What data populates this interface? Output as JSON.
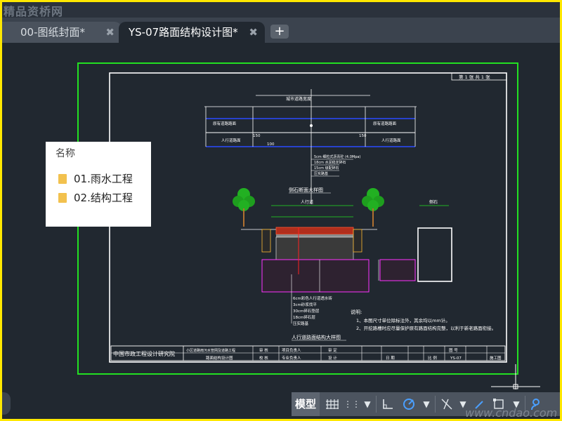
{
  "watermark_top": "精品资桥网",
  "watermark_bottom": "www.cndao.com",
  "tabs": [
    {
      "label": "00-图纸封面*",
      "close": "✖"
    },
    {
      "label": "YS-07路面结构设计图*",
      "close": "✖"
    }
  ],
  "tab_add": "+",
  "popup": {
    "header": "名称",
    "items": [
      {
        "label": "01.雨水工程"
      },
      {
        "label": "02.结构工程"
      }
    ]
  },
  "status": {
    "model": "模型",
    "icons": [
      "grid-icon",
      "dropdown-icon",
      "ortho-icon",
      "polar-icon",
      "dropdown-icon",
      "osnap-icon",
      "dropdown-icon",
      "annotation-icon",
      "dropdown-icon",
      "user-icon"
    ]
  },
  "drawing": {
    "sheet_no": "第 1 张 共 1 张",
    "road_width": "城市道路宽度",
    "label_left_1": "原有道路路面",
    "label_left_2": "人行道路面",
    "label_right_1": "原有道路路面",
    "label_right_2": "人行道路面",
    "dim_1": "150",
    "dim_2": "100",
    "dim_3": "150",
    "layer_1": "5cm 细粒式沥青砼 (4.0Mpa)",
    "layer_2": "18cm 水泥稳定碎石",
    "layer_3": "15cm 级配碎石",
    "layer_4": "压实路基",
    "section_title": "侧石断面大样图",
    "sidewalk_label": "人行道",
    "curb_label": "侧石",
    "mat_1": "6cm彩色人行道透水砖",
    "mat_2": "3cm砂浆找平",
    "mat_3": "30cm碎石垫层",
    "mat_4": "18cm碎石层",
    "mat_5": "压实路基",
    "bottom_title": "人行道路面结构大样图",
    "notes_title": "说明:",
    "note_1": "1、本图尺寸单位除标注外，其余均以mm计。",
    "note_2": "2、开挖路槽时应尽量保护原有路面结构完整，以利于新老路面衔接。",
    "titleblock_company": "中国市政工程设计研究院",
    "titleblock_project": "小区道路雨污水管网及道路工程",
    "titleblock_drawing": "路面结构设计图",
    "tb_design": "设 计",
    "tb_check": "校 核",
    "tb_review": "审 核",
    "tb_approve": "审 定",
    "tb_leader": "项目负责人",
    "tb_pro_leader": "专业负责人",
    "tb_date": "日 期",
    "tb_scale": "比 例",
    "tb_drawing_no": "图 号",
    "tb_no_value": "YS-07",
    "tb_phase": "施工图"
  }
}
